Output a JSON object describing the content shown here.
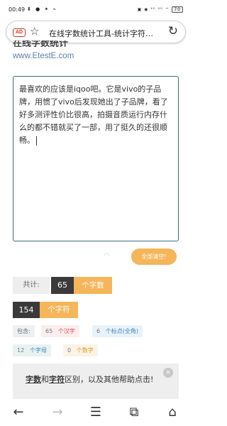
{
  "status": {
    "time": "00:49",
    "notifications": "⬇ ● ✦ ⌁",
    "system": "▣ ◉ ⁴ᴳ ⁴ᴳ ⌔",
    "battery": "70"
  },
  "browser": {
    "ad_badge": "AD",
    "title": "在线字数统计工具-统计字符…",
    "star_icon": "☆",
    "reload_icon": "↻"
  },
  "site": {
    "name": "在线字数统计",
    "url": "www.EtestE.com"
  },
  "editor": {
    "text": "最喜欢的应该是iqoo吧。它是vivo的子品牌，用惯了vivo后发现她出了子品牌，看了好多测评性价比很高，拍摄音质运行内存什么的都不错就买了一部，用了挺久的还很顺畅。"
  },
  "actions": {
    "clear_all": "全部清空!"
  },
  "stats": {
    "total_label": "共计:",
    "word_count": "65",
    "word_unit": "个字数",
    "char_count": "154",
    "char_unit": "个字符",
    "contains_label": "包含:",
    "hanzi_count": "65",
    "hanzi_label": "个汉字",
    "punct_count": "6",
    "punct_label": "个标点(全角)",
    "letter_count": "12",
    "letter_label": "个字母",
    "digit_count": "0",
    "digit_label": "个数字"
  },
  "info": {
    "part1": "字数",
    "part2": "和",
    "part3": "字符",
    "part4": "区别，以及其他帮助点击!",
    "close_icon": "×"
  },
  "nav": {
    "back": "←",
    "forward": "→",
    "menu": "☰",
    "tabs": "⧉",
    "home": "⌂"
  }
}
